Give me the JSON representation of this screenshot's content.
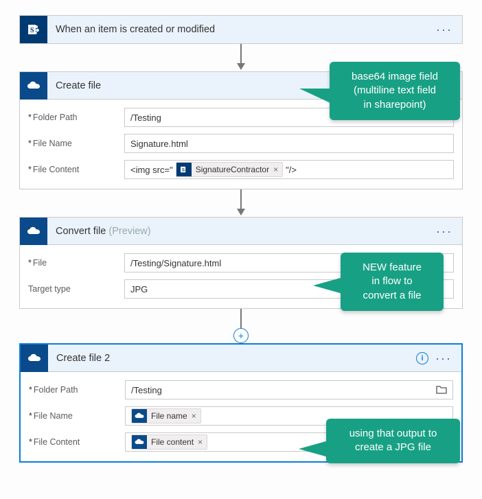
{
  "trigger": {
    "title": "When an item is created or modified"
  },
  "create_file": {
    "title": "Create file",
    "fields": {
      "folder_label": "Folder Path",
      "folder_value": "/Testing",
      "name_label": "File Name",
      "name_value": "Signature.html",
      "content_label": "File Content",
      "content_prefix": "<img src=\" ",
      "content_token": "SignatureContractor",
      "content_suffix": " \"/>"
    }
  },
  "convert_file": {
    "title": "Convert file",
    "preview_suffix": "(Preview)",
    "fields": {
      "file_label": "File",
      "file_value": "/Testing/Signature.html",
      "type_label": "Target type",
      "type_value": "JPG"
    }
  },
  "create_file_2": {
    "title": "Create file 2",
    "fields": {
      "folder_label": "Folder Path",
      "folder_value": "/Testing",
      "name_label": "File Name",
      "name_token": "File name",
      "content_label": "File Content",
      "content_token": "File content"
    }
  },
  "callouts": {
    "c1_l1": "base64 image field",
    "c1_l2": "(multiline text field",
    "c1_l3": "in sharepoint)",
    "c2_l1": "NEW feature",
    "c2_l2": "in flow to",
    "c2_l3": "convert a file",
    "c3_l1": "using that output to",
    "c3_l2": "create a JPG file"
  },
  "misc": {
    "ellipsis": "···",
    "info": "i",
    "plus": "+",
    "token_x": "×"
  }
}
